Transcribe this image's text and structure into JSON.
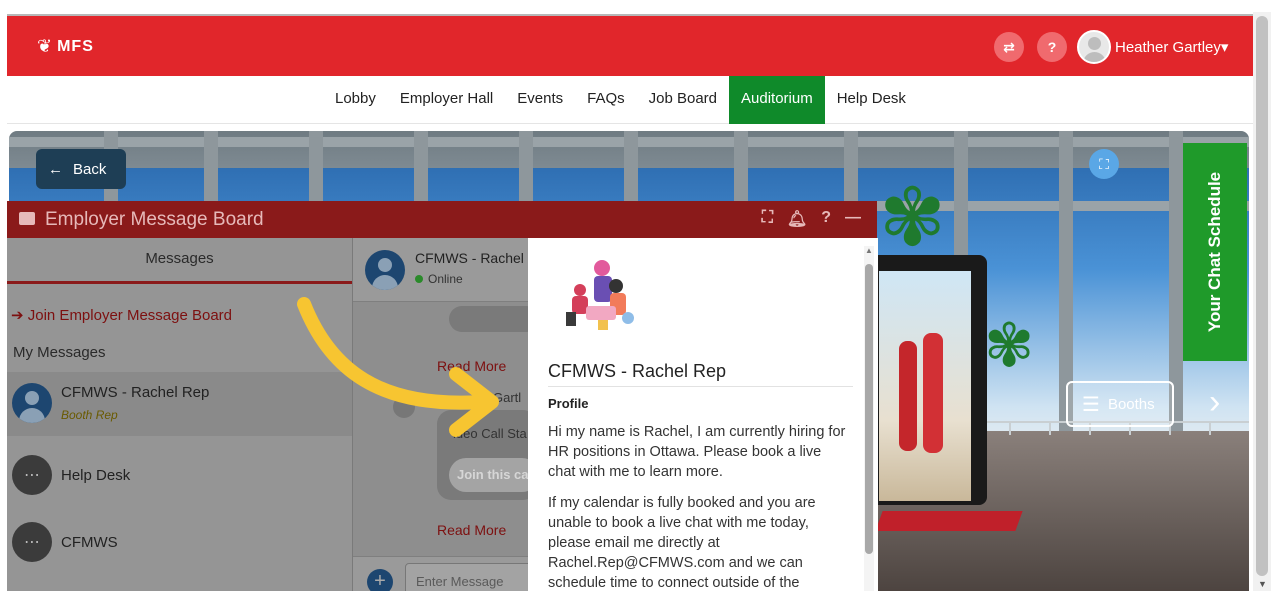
{
  "header": {
    "logo_text": "MFS",
    "user_name": "Heather Gartley",
    "help_label": "?",
    "user_caret": "▾"
  },
  "nav": {
    "items": [
      "Lobby",
      "Employer Hall",
      "Events",
      "FAQs",
      "Job Board",
      "Auditorium",
      "Help Desk"
    ],
    "active": "Auditorium"
  },
  "scene": {
    "back_label": "Back",
    "booths_label": "Booths",
    "chat_schedule_label": "Your Chat Schedule"
  },
  "message_board": {
    "title": "Employer Message Board",
    "tab_label": "Messages",
    "join_label": "Join Employer Message Board",
    "section_label": "My Messages",
    "conversations": [
      {
        "name": "CFMWS - Rachel Rep",
        "role": "Booth Rep"
      },
      {
        "name": "Help Desk",
        "role": ""
      },
      {
        "name": "CFMWS",
        "role": ""
      }
    ]
  },
  "conversation": {
    "name": "CFMWS - Rachel",
    "status": "Online",
    "read_more_1": "Read More",
    "sender_partial": "Gartl",
    "video_call_partial": "ideo Call Sta",
    "join_call_partial": "Join this ca",
    "read_more_2": "Read More",
    "input_placeholder": "Enter Message"
  },
  "profile": {
    "name": "CFMWS - Rachel Rep",
    "label": "Profile",
    "paragraph_1": "Hi my name is Rachel, I am currently hiring for HR positions in Ottawa.  Please book a live chat with me to learn more.",
    "paragraph_2": "If my calendar is fully booked and you are unable to book a live chat with me today, please email me directly at Rachel.Rep@CFMWS.com and we can schedule time to connect outside of the"
  },
  "colors": {
    "header_red": "#e1262b",
    "nav_active_green": "#0f8a2a",
    "chat_schedule_green": "#1f9a2a",
    "board_header": "#8a1a1a",
    "arrow_yellow": "#f7c531"
  }
}
